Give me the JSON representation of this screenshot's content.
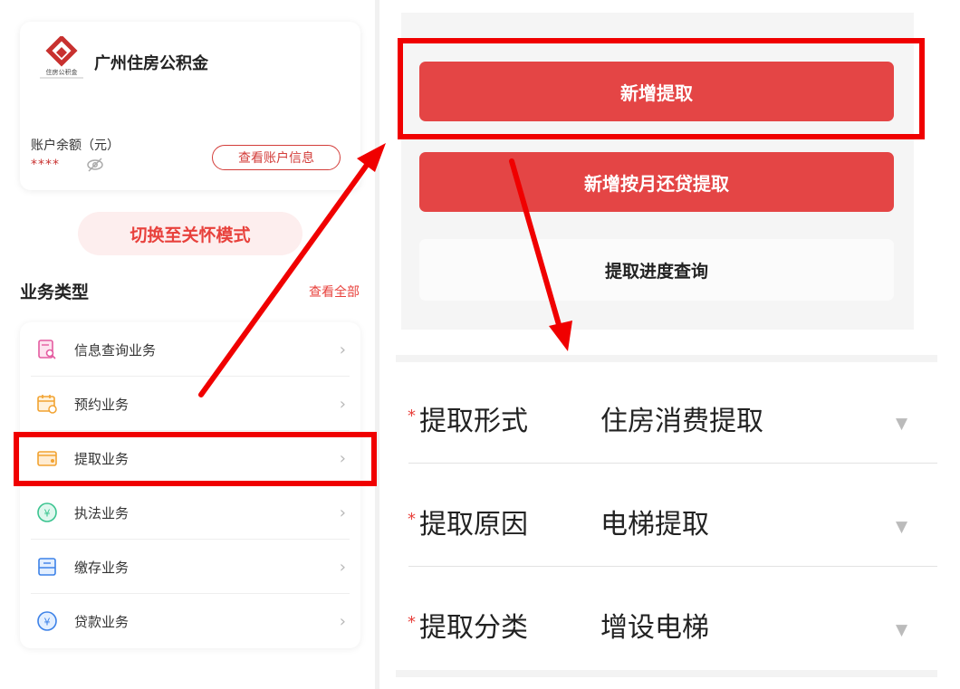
{
  "account": {
    "brand_name": "广州住房公积金",
    "logo_caption": "住房公积金",
    "balance_label": "账户余额（元）",
    "balance_masked": "****",
    "view_account_label": "查看账户信息"
  },
  "care_mode_label": "切换至关怀模式",
  "services": {
    "title": "业务类型",
    "view_all": "查看全部",
    "items": [
      {
        "label": "信息查询业务",
        "icon": "document-search-icon"
      },
      {
        "label": "预约业务",
        "icon": "calendar-clock-icon"
      },
      {
        "label": "提取业务",
        "icon": "wallet-icon"
      },
      {
        "label": "执法业务",
        "icon": "yuan-circle-icon"
      },
      {
        "label": "缴存业务",
        "icon": "inbox-icon"
      },
      {
        "label": "贷款业务",
        "icon": "yuan-coin-icon"
      }
    ]
  },
  "withdraw_actions": {
    "new_withdraw": "新增提取",
    "new_monthly_repay_withdraw": "新增按月还贷提取",
    "progress_query": "提取进度查询"
  },
  "form": {
    "fields": [
      {
        "label": "提取形式",
        "value": "住房消费提取"
      },
      {
        "label": "提取原因",
        "value": "电梯提取"
      },
      {
        "label": "提取分类",
        "value": "增设电梯"
      }
    ]
  },
  "colors": {
    "primary_red": "#e44545",
    "annotation_red": "#f00000",
    "care_mode_bg": "#fdeeee"
  }
}
